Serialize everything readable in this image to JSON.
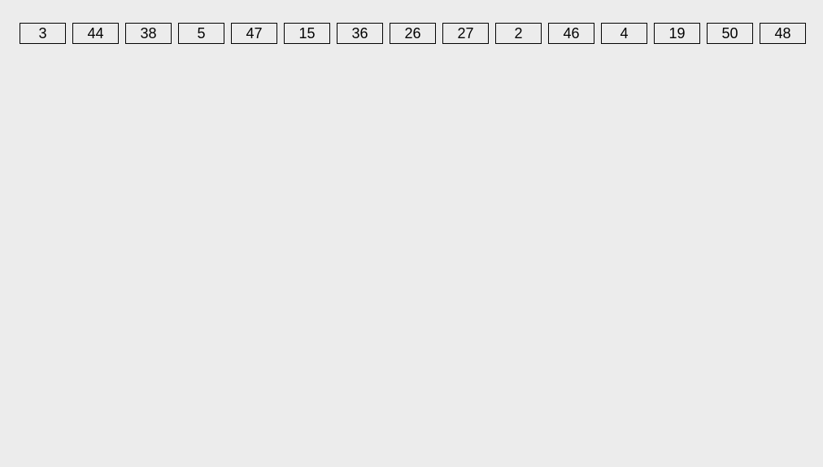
{
  "values": [
    3,
    44,
    38,
    5,
    47,
    15,
    36,
    26,
    27,
    2,
    46,
    4,
    19,
    50,
    48
  ]
}
